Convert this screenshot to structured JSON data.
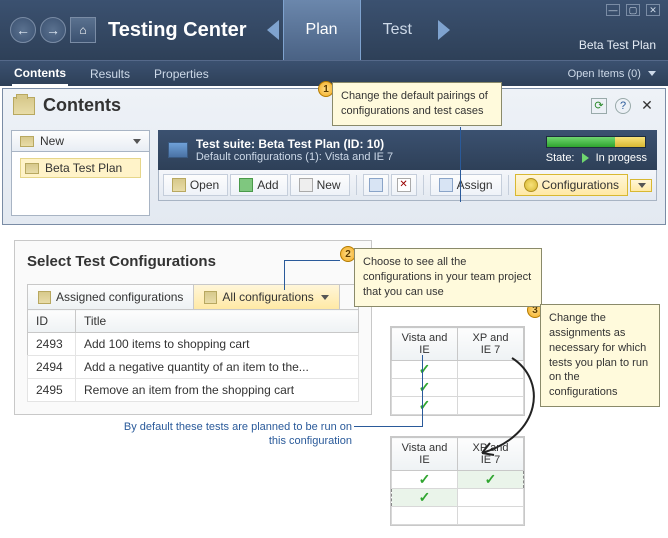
{
  "chrome": {
    "title": "Testing Center",
    "tabs": [
      {
        "label": "Plan",
        "active": true
      },
      {
        "label": "Test",
        "active": false
      }
    ],
    "plan_name": "Beta Test Plan"
  },
  "subnav": {
    "items": [
      {
        "label": "Contents",
        "active": true
      },
      {
        "label": "Results",
        "active": false
      },
      {
        "label": "Properties",
        "active": false
      }
    ],
    "open_items_label": "Open Items",
    "open_items_count": "(0)"
  },
  "contents": {
    "title": "Contents",
    "tree": {
      "new_label": "New",
      "items": [
        {
          "label": "Beta Test Plan"
        }
      ]
    },
    "suite": {
      "title_prefix": "Test suite:",
      "title": "Beta Test Plan (ID: 10)",
      "default_cfg": "Default configurations (1): Vista and IE 7",
      "state_label": "State:",
      "state_value": "In progess"
    },
    "toolbar": {
      "open": "Open",
      "add": "Add",
      "new": "New",
      "assign": "Assign",
      "configurations": "Configurations"
    }
  },
  "callouts": {
    "c1": "Change the default pairings of configurations and test cases",
    "c2": "Choose to see all the configurations in your team project that you can use",
    "c3": "Change the assignments as necessary for which tests you plan to run on the configurations",
    "note": "By default these tests are planned to be run on this configuration"
  },
  "select": {
    "title": "Select Test Configurations",
    "tabs": {
      "assigned": "Assigned configurations",
      "all": "All configurations"
    },
    "columns": {
      "id": "ID",
      "title": "Title"
    },
    "rows": [
      {
        "id": "2493",
        "title": "Add 100 items to shopping cart"
      },
      {
        "id": "2494",
        "title": "Add a negative quantity of an item to the..."
      },
      {
        "id": "2495",
        "title": "Remove an item from the shopping cart"
      }
    ]
  },
  "cfg_cols": {
    "a": "Vista and IE 7",
    "a_short": "Vista and IE",
    "b": "XP and IE 7"
  }
}
